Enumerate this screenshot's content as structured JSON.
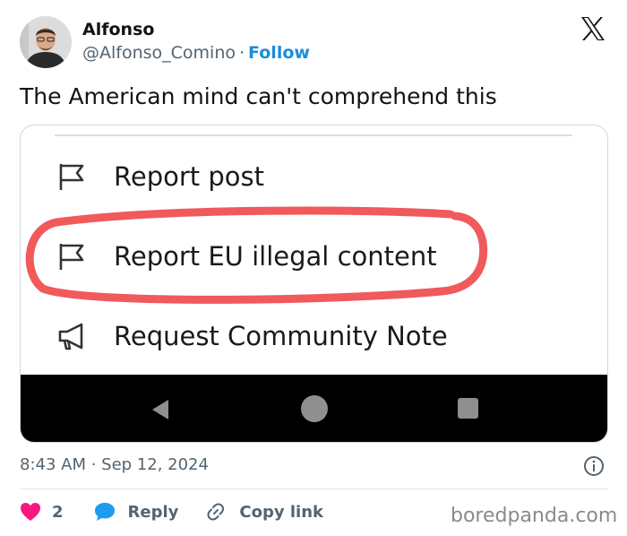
{
  "user": {
    "name": "Alfonso",
    "handle": "@Alfonso_Comino",
    "separator": "·",
    "follow_label": "Follow"
  },
  "tweet": {
    "text": "The American mind can't comprehend this"
  },
  "media": {
    "menu": [
      {
        "label": "Report post",
        "icon": "flag-icon"
      },
      {
        "label": "Report EU illegal content",
        "icon": "flag-icon",
        "highlighted": true
      },
      {
        "label": "Request Community Note",
        "icon": "megaphone-icon"
      }
    ],
    "highlight_color": "#f05a5a",
    "navbar_buttons": [
      "back-icon",
      "home-icon",
      "recents-icon"
    ]
  },
  "meta": {
    "timestamp": "8:43 AM · Sep 12, 2024"
  },
  "actions": {
    "like_count": "2",
    "reply_label": "Reply",
    "copy_label": "Copy link"
  },
  "watermark": "boredpanda.com",
  "colors": {
    "accent": "#1d9bf0",
    "like": "#f91880",
    "text_secondary": "#536471"
  }
}
